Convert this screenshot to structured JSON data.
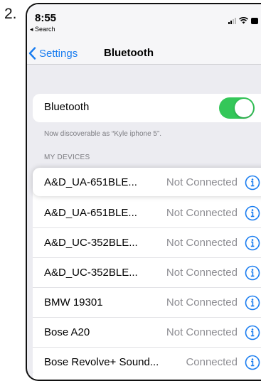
{
  "step_number": "2.",
  "status_bar": {
    "time": "8:55",
    "back_app": "◂ Search"
  },
  "nav": {
    "back_label": "Settings",
    "title": "Bluetooth"
  },
  "bluetooth": {
    "label": "Bluetooth",
    "enabled": true
  },
  "discoverable_text": "Now discoverable as “Kyle iphone 5”.",
  "section_header": "MY DEVICES",
  "devices": [
    {
      "name": "A&D_UA-651BLE...",
      "status": "Not Connected"
    },
    {
      "name": "A&D_UA-651BLE...",
      "status": "Not Connected"
    },
    {
      "name": "A&D_UC-352BLE...",
      "status": "Not Connected"
    },
    {
      "name": "A&D_UC-352BLE...",
      "status": "Not Connected"
    },
    {
      "name": "BMW 19301",
      "status": "Not Connected"
    },
    {
      "name": "Bose A20",
      "status": "Not Connected"
    },
    {
      "name": "Bose Revolve+ Sound...",
      "status": "Connected"
    }
  ],
  "colors": {
    "accent": "#1a7df0",
    "toggle_on": "#34c759",
    "secondary_text": "#8e8e93",
    "background": "#ececf1"
  },
  "icons": {
    "back": "chevron-left-icon",
    "info": "info-circle-icon"
  }
}
